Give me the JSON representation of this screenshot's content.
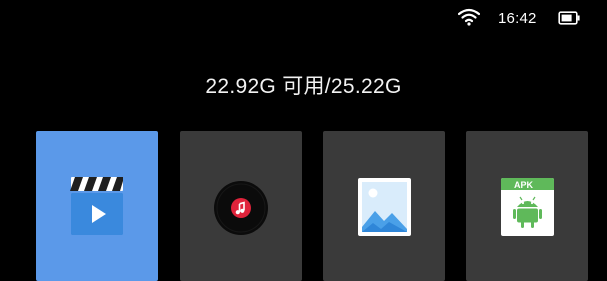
{
  "status_bar": {
    "time": "16:42",
    "wifi_icon": "wifi-icon",
    "battery_icon": "battery-icon"
  },
  "storage": {
    "text": "22.92G 可用/25.22G"
  },
  "tiles": [
    {
      "name": "video",
      "icon": "video-clapperboard-icon",
      "color": "#5b99e9"
    },
    {
      "name": "music",
      "icon": "music-record-icon",
      "color": "#3a3a3a"
    },
    {
      "name": "image",
      "icon": "image-picture-icon",
      "color": "#3a3a3a"
    },
    {
      "name": "apk",
      "icon": "apk-android-icon",
      "color": "#3a3a3a",
      "badge": "APK"
    }
  ],
  "colors": {
    "background": "#000000",
    "tile_active": "#5b99e9",
    "tile_inactive": "#3a3a3a",
    "music_red": "#e0233b",
    "apk_green": "#5fb95a"
  }
}
